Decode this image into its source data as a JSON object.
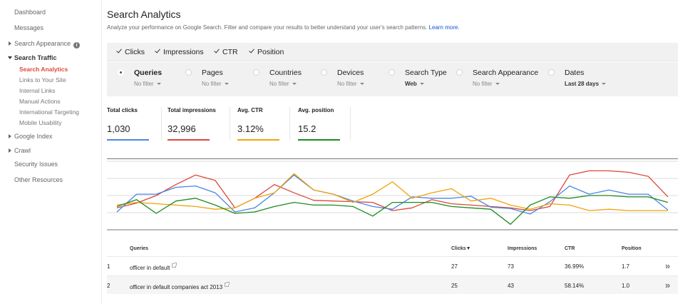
{
  "sidebar": {
    "dashboard": "Dashboard",
    "messages": "Messages",
    "search_appearance": "Search Appearance",
    "info_icon": "i",
    "search_traffic": "Search Traffic",
    "sub_items": [
      "Search Analytics",
      "Links to Your Site",
      "Internal Links",
      "Manual Actions",
      "International Targeting",
      "Mobile Usability"
    ],
    "google_index": "Google Index",
    "crawl": "Crawl",
    "security_issues": "Security Issues",
    "other_resources": "Other Resources"
  },
  "header": {
    "title": "Search Analytics",
    "subtitle": "Analyze your performance on Google Search. Filter and compare your results to better understand your user's search patterns.",
    "learn_more": "Learn more."
  },
  "metrics": [
    "Clicks",
    "Impressions",
    "CTR",
    "Position"
  ],
  "groups": [
    {
      "label": "Queries",
      "filter": "No filter",
      "selected": true
    },
    {
      "label": "Pages",
      "filter": "No filter",
      "selected": false
    },
    {
      "label": "Countries",
      "filter": "No filter",
      "selected": false
    },
    {
      "label": "Devices",
      "filter": "No filter",
      "selected": false
    },
    {
      "label": "Search Type",
      "filter": "Web",
      "selected": false
    },
    {
      "label": "Search Appearance",
      "filter": "No filter",
      "selected": false
    },
    {
      "label": "Dates",
      "filter": "Last 28 days",
      "selected": false
    }
  ],
  "totals": [
    {
      "label": "Total clicks",
      "value": "1,030",
      "color": "#4a86e8"
    },
    {
      "label": "Total impressions",
      "value": "32,996",
      "color": "#d9483b"
    },
    {
      "label": "Avg. CTR",
      "value": "3.12%",
      "color": "#f0a30a"
    },
    {
      "label": "Avg. position",
      "value": "15.2",
      "color": "#1e8a1e"
    }
  ],
  "chart_data": {
    "type": "line",
    "ylim": [
      0,
      100
    ],
    "series": [
      {
        "color": "#d9483b",
        "values": [
          32,
          39,
          50,
          66,
          80,
          72,
          32,
          46,
          66,
          54,
          43,
          42,
          41,
          40,
          28,
          32,
          44,
          38,
          36,
          34,
          32,
          28,
          34,
          80,
          86,
          86,
          84,
          78,
          48
        ]
      },
      {
        "color": "#4a86e8",
        "values": [
          26,
          52,
          52,
          62,
          64,
          54,
          26,
          32,
          54,
          80,
          58,
          52,
          42,
          34,
          30,
          48,
          46,
          46,
          49,
          33,
          31,
          23,
          41,
          64,
          52,
          58,
          52,
          52,
          29
        ]
      },
      {
        "color": "#f0a30a",
        "values": [
          36,
          40,
          38,
          36,
          34,
          30,
          32,
          46,
          54,
          82,
          58,
          52,
          40,
          52,
          70,
          46,
          54,
          60,
          42,
          46,
          36,
          30,
          38,
          36,
          28,
          30,
          28,
          28,
          28
        ]
      },
      {
        "color": "#1e8a1e",
        "values": [
          34,
          44,
          24,
          42,
          46,
          36,
          24,
          26,
          34,
          40,
          36,
          36,
          34,
          20,
          40,
          40,
          40,
          34,
          32,
          30,
          8,
          36,
          48,
          46,
          50,
          50,
          48,
          48,
          40
        ]
      }
    ]
  },
  "table": {
    "headers": {
      "queries": "Queries",
      "clicks": "Clicks▼",
      "impressions": "Impressions",
      "ctr": "CTR",
      "position": "Position"
    },
    "rows": [
      {
        "num": "1",
        "query": "officer in default",
        "clicks": "27",
        "impressions": "73",
        "ctr": "36.99%",
        "position": "1.7"
      },
      {
        "num": "2",
        "query": "officer in default companies act 2013",
        "clicks": "25",
        "impressions": "43",
        "ctr": "58.14%",
        "position": "1.0"
      }
    ],
    "more_icon": "»"
  }
}
